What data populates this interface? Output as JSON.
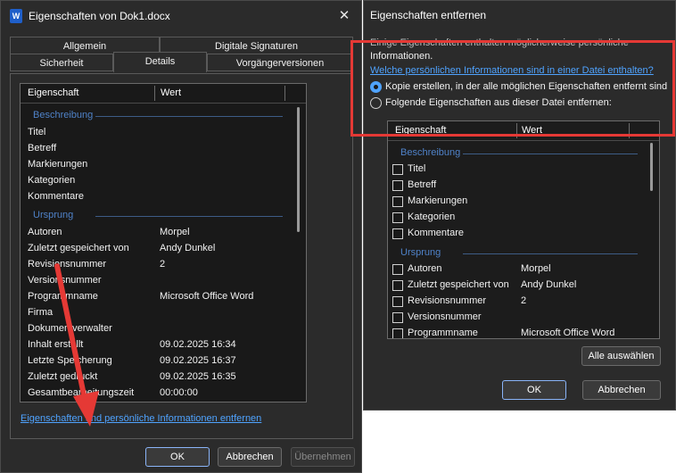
{
  "dialog_main": {
    "title": "Eigenschaften von Dok1.docx",
    "app_icon_letter": "W",
    "tabs_row1": [
      "Allgemein",
      "Digitale Signaturen"
    ],
    "tabs_row2": [
      "Sicherheit",
      "Details",
      "Vorgängerversionen"
    ],
    "active_tab": "Details",
    "columns": [
      "Eigenschaft",
      "Wert"
    ],
    "groups": [
      {
        "name": "Beschreibung",
        "rows": [
          {
            "label": "Titel",
            "value": ""
          },
          {
            "label": "Betreff",
            "value": ""
          },
          {
            "label": "Markierungen",
            "value": ""
          },
          {
            "label": "Kategorien",
            "value": ""
          },
          {
            "label": "Kommentare",
            "value": ""
          }
        ]
      },
      {
        "name": "Ursprung",
        "rows": [
          {
            "label": "Autoren",
            "value": "Morpel"
          },
          {
            "label": "Zuletzt gespeichert von",
            "value": "Andy Dunkel"
          },
          {
            "label": "Revisionsnummer",
            "value": "2"
          },
          {
            "label": "Versionsnummer",
            "value": ""
          },
          {
            "label": "Programmname",
            "value": "Microsoft Office Word"
          },
          {
            "label": "Firma",
            "value": ""
          },
          {
            "label": "Dokumentverwalter",
            "value": ""
          },
          {
            "label": "Inhalt erstellt",
            "value": "09.02.2025 16:34"
          },
          {
            "label": "Letzte Speicherung",
            "value": "09.02.2025 16:37"
          },
          {
            "label": "Zuletzt gedruckt",
            "value": "09.02.2025 16:35"
          },
          {
            "label": "Gesamtbearbeitungszeit",
            "value": "00:00:00"
          }
        ]
      }
    ],
    "remove_link": "Eigenschaften und persönliche Informationen entfernen",
    "buttons": {
      "ok": "OK",
      "cancel": "Abbrechen",
      "apply": "Übernehmen"
    }
  },
  "dialog_remove": {
    "title": "Eigenschaften entfernen",
    "info_text_line1": "Einige Eigenschaften enthalten möglicherweise persönliche",
    "info_text_line2": "Informationen.",
    "help_link": "Welche persönlichen Informationen sind in einer Datei enthalten?",
    "option_copy": "Kopie erstellen, in der alle möglichen Eigenschaften entfernt sind",
    "option_remove": "Folgende Eigenschaften aus dieser Datei entfernen:",
    "selected_option": "copy",
    "columns": [
      "Eigenschaft",
      "Wert"
    ],
    "groups": [
      {
        "name": "Beschreibung",
        "rows": [
          {
            "label": "Titel",
            "value": ""
          },
          {
            "label": "Betreff",
            "value": ""
          },
          {
            "label": "Markierungen",
            "value": ""
          },
          {
            "label": "Kategorien",
            "value": ""
          },
          {
            "label": "Kommentare",
            "value": ""
          }
        ]
      },
      {
        "name": "Ursprung",
        "rows": [
          {
            "label": "Autoren",
            "value": "Morpel"
          },
          {
            "label": "Zuletzt gespeichert von",
            "value": "Andy Dunkel"
          },
          {
            "label": "Revisionsnummer",
            "value": "2"
          },
          {
            "label": "Versionsnummer",
            "value": ""
          },
          {
            "label": "Programmname",
            "value": "Microsoft Office Word"
          }
        ]
      }
    ],
    "buttons": {
      "select_all": "Alle auswählen",
      "ok": "OK",
      "cancel": "Abbrechen"
    }
  },
  "colors": {
    "dialog_bg": "#2b2b2b",
    "list_bg": "#191919",
    "link": "#4fa3ff",
    "group_header": "#4f82c8",
    "highlight_box": "#e53935",
    "arrow": "#e53935"
  }
}
